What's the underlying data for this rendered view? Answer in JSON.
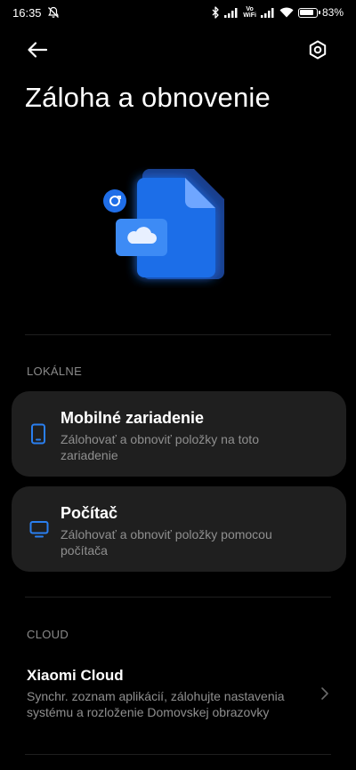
{
  "status_bar": {
    "time": "16:35",
    "vowifi_top": "Vo",
    "vowifi_bottom": "WiFi",
    "battery": "83%",
    "battery_level": 0.83,
    "icons": [
      "mute-icon",
      "bluetooth-icon",
      "signal-icon",
      "vowifi-icon",
      "signal-icon",
      "wifi-icon",
      "battery-icon"
    ]
  },
  "header": {
    "title": "Záloha a obnovenie",
    "back_icon": "arrow-left-icon",
    "settings_icon": "gear-icon"
  },
  "colors": {
    "background": "#000000",
    "card": "#1f1f1f",
    "accent": "#2a7ff0",
    "muted_text": "#8f8f8f"
  },
  "local_section": {
    "label": "LOKÁLNE",
    "items": [
      {
        "title": "Mobilné zariadenie",
        "subtitle": "Zálohovať a obnoviť položky na toto zariadenie",
        "icon": "smartphone-icon"
      },
      {
        "title": "Počítač",
        "subtitle": "Zálohovať a obnoviť položky pomocou počítača",
        "icon": "monitor-icon"
      }
    ]
  },
  "cloud_section": {
    "label": "CLOUD",
    "items": [
      {
        "title": "Xiaomi Cloud",
        "subtitle": "Synchr. zoznam aplikácií, zálohujte nastavenia systému a rozloženie Domovskej obrazovky",
        "icon": "chevron-right-icon"
      }
    ]
  }
}
